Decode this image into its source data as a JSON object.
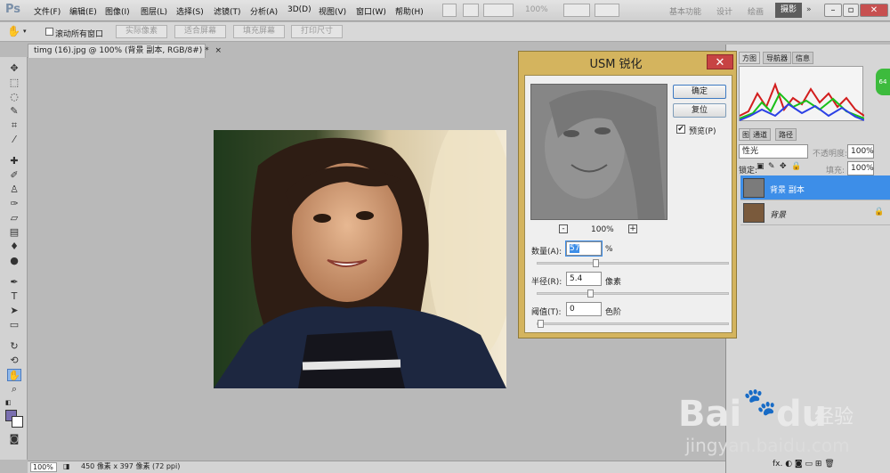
{
  "app": {
    "logo": "Ps"
  },
  "menu": [
    "文件(F)",
    "编辑(E)",
    "图像(I)",
    "图层(L)",
    "选择(S)",
    "滤镜(T)",
    "分析(A)",
    "3D(D)",
    "视图(V)",
    "窗口(W)",
    "帮助(H)"
  ],
  "toolbar_top": {
    "zoom": "100%"
  },
  "workspaces": [
    "基本功能",
    "设计",
    "绘画"
  ],
  "workspace_active": "摄影",
  "workspace_more": "»",
  "window_buttons": {
    "min": "–",
    "max": "▫",
    "close": "✕"
  },
  "options": {
    "scroll_all": "滚动所有窗口",
    "actual_pixels": "实际像素",
    "fit_screen": "适合屏幕",
    "fill_screen": "填充屏幕",
    "print_size": "打印尺寸"
  },
  "document": {
    "tab_title": "timg (16).jpg @ 100% (背景 副本, RGB/8#) *",
    "tab_close": "×"
  },
  "status": {
    "zoom": "100%",
    "info": "450 像素 x 397 像素 (72 ppi)"
  },
  "panels": {
    "tabs_top": [
      "方图",
      "导航器",
      "信息"
    ],
    "tabs_layers": [
      "图",
      "通道",
      "路径"
    ],
    "blend_mode": "性光",
    "opacity_label": "不透明度:",
    "opacity_value": "100%",
    "lock_label": "锁定:",
    "fill_label": "填充:",
    "fill_value": "100%",
    "layers": [
      {
        "name": "背景 副本"
      },
      {
        "name": "背景"
      }
    ],
    "bottom_icons": "fx.  ◐  ◙  ▭  ⊞  🗑"
  },
  "dialog": {
    "title": "USM 锐化",
    "close": "✕",
    "ok": "确定",
    "reset": "复位",
    "preview_label": "预览(P)",
    "preview_checked": true,
    "zoom_minus": "-",
    "zoom_plus": "+",
    "preview_zoom": "100%",
    "amount_label": "数量(A):",
    "amount_value": "57",
    "amount_unit": "%",
    "radius_label": "半径(R):",
    "radius_value": "5.4",
    "radius_unit": "像素",
    "threshold_label": "阈值(T):",
    "threshold_value": "0",
    "threshold_unit": "色阶",
    "amount_slider": 0.3,
    "radius_slider": 0.27,
    "threshold_slider": 0.0
  },
  "watermark": {
    "brand": "Bai",
    "brand2": "du",
    "cn": "经验",
    "url": "jingyan.baidu.com"
  },
  "colors": {
    "accent": "#3d8ee8",
    "dialog_frame": "#d4b45e",
    "close_red": "#c74343",
    "fg_swatch": "#7a6fb0"
  }
}
